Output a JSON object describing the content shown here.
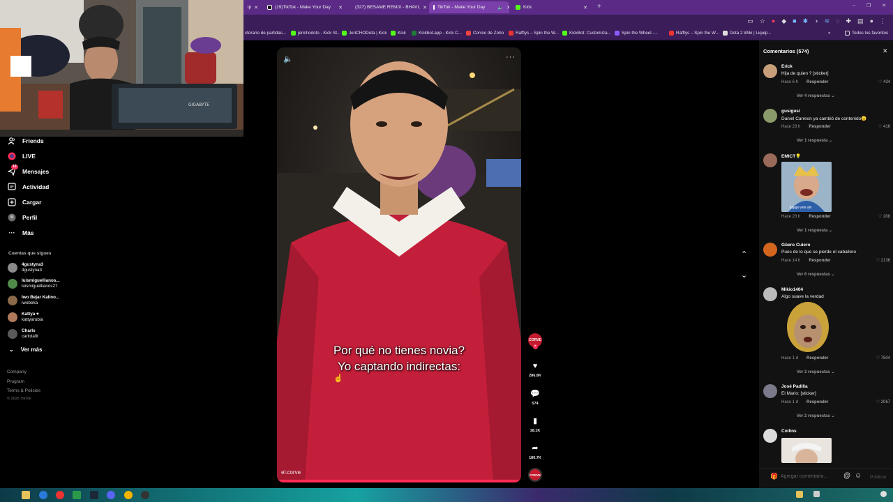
{
  "browser": {
    "tabs": [
      {
        "label": "ip",
        "active": false
      },
      {
        "label": "(19)TikTok - Make Your Day",
        "active": false
      },
      {
        "label": "(327) BESAME REMIX - BHAVI,",
        "active": false
      },
      {
        "label": "TikTok - Make Your Day",
        "active": true
      },
      {
        "label": "Kick",
        "active": false
      }
    ],
    "bookmarks": [
      "ctorario de partidas...",
      "jerichodoto - Kick St...",
      "JeriCHODota | Kick",
      "Kick",
      "Kickbot.app - Kick C...",
      "Correo de Zoho",
      "Rafflys – Spin the W...",
      "KickBot: Customiza...",
      "Spin the Wheel -...",
      "Rafflys – Spin the W...",
      "Dota 2 Wiki | Liquip..."
    ],
    "bookmarks_all": "Todos los favoritos"
  },
  "sidebar": {
    "nav": [
      {
        "label": "Friends",
        "icon": "friends-icon"
      },
      {
        "label": "LIVE",
        "icon": "live-icon"
      },
      {
        "label": "Mensajes",
        "icon": "messages-icon",
        "badge": "19"
      },
      {
        "label": "Actividad",
        "icon": "activity-icon"
      },
      {
        "label": "Cargar",
        "icon": "upload-icon"
      },
      {
        "label": "Perfil",
        "icon": "profile-icon"
      },
      {
        "label": "Más",
        "icon": "more-icon"
      }
    ],
    "following_title": "Cuentas que sigues",
    "following": [
      {
        "name": "4gustyna3",
        "handle": "4gustyna3"
      },
      {
        "name": "luismiguellianos...",
        "handle": "luismiguellianos27"
      },
      {
        "name": "Iwo Bejar Kalino...",
        "handle": "iwobeka"
      },
      {
        "name": "Kattya ♥",
        "handle": "kattyarubia"
      },
      {
        "name": "Charls",
        "handle": "carlotafit"
      }
    ],
    "see_more": "Ver más",
    "footer": [
      "Company",
      "Program",
      "Terms & Policies",
      "© 2025 TikTok"
    ]
  },
  "video": {
    "caption_line1": "Por qué no tienes novia?",
    "caption_line2": "Yo captando indirectas:",
    "watermark": "el.corve",
    "likes": "286.8K",
    "comments": "574",
    "saves": "18.1K",
    "shares": "180.7K",
    "author_badge": "CORVE"
  },
  "comments": {
    "title": "Comentarios (574)",
    "input_placeholder": "Agregar comentario...",
    "publish": "Publicar",
    "reply_label": "Responder",
    "items": [
      {
        "name": "Erick",
        "text": "Hija de quien ? [sticker]",
        "time": "Hace 6 h",
        "likes": "434",
        "more": "Ver 4 respuestas"
      },
      {
        "name": "gusigusi",
        "text": "Daniel Carreon ya cambió de contenido😑",
        "time": "Hace 23 h",
        "likes": "416",
        "more": "Ver 1 respuesta"
      },
      {
        "name": "EMICT💡",
        "text": "",
        "time": "Hace 23 h",
        "likes": "208",
        "more": "Ver 1 respuesta",
        "sticker_caption": "ijajaja vete alv"
      },
      {
        "name": "Güero Cuiero",
        "text": "Pues de lo que se pierde el caballero",
        "time": "Hace 14 h",
        "likes": "2136",
        "more": "Ver 6 respuestas"
      },
      {
        "name": "Mikio1404",
        "text": "Algo suave la verdad",
        "time": "Hace 1 d",
        "likes": "7504",
        "more": "Ver 2 respuestas"
      },
      {
        "name": "José Padilla",
        "text": "El Mario: [sticker]",
        "time": "Hace 1 d",
        "likes": "2067",
        "more": "Ver 2 respuestas"
      },
      {
        "name": "Collins",
        "text": "",
        "time": "",
        "likes": "",
        "more": ""
      }
    ]
  },
  "colors": {
    "accent": "#fe2c55",
    "browser_tabbar": "#5b2a86",
    "browser_toolbar": "#3a1d59",
    "panel_bg": "#121212"
  }
}
